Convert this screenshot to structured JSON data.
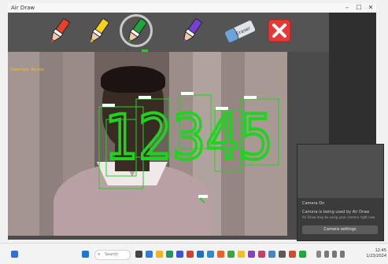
{
  "window": {
    "title": "Air Draw",
    "controls": [
      "–",
      "☐",
      "✕"
    ]
  },
  "toolbar": {
    "tools": [
      {
        "name": "red-marker",
        "color": "#e8402a"
      },
      {
        "name": "yellow-marker",
        "color": "#f4d21a"
      },
      {
        "name": "green-marker",
        "color": "#1fa83a",
        "selected": true
      },
      {
        "name": "purple-marker",
        "color": "#7b3fd6"
      },
      {
        "name": "eraser",
        "color": "#d9dde3",
        "label": "Eraser"
      },
      {
        "name": "close",
        "color": "#e53935"
      }
    ]
  },
  "camera": {
    "info_lines": [
      "_ _ _ _ _ _ _ _ _ _ _",
      "_ _ _ _ _ _ _ _ _ _ _",
      "_ _ _ _ _ _ _ _",
      "Detected: Person"
    ],
    "drawn_text": "12345",
    "stroke_color": "#1fd41f"
  },
  "popup": {
    "title": "Camera On",
    "line1": "Camera is being used by Air Draw",
    "line2": "Air Draw may be using your camera right now",
    "button": "Camera settings"
  },
  "taskbar": {
    "search_placeholder": "Search",
    "time": "12:45",
    "date": "1/23/2024"
  }
}
